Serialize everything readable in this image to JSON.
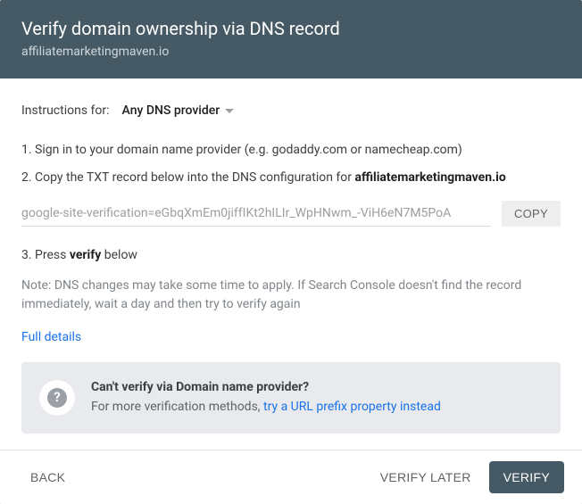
{
  "header": {
    "title": "Verify domain ownership via DNS record",
    "subtitle": "affiliatemarketingmaven.io"
  },
  "instructions": {
    "label": "Instructions for:",
    "provider": "Any DNS provider"
  },
  "steps": {
    "step1": "1. Sign in to your domain name provider (e.g. godaddy.com or namecheap.com)",
    "step2_prefix": "2. Copy the TXT record below into the DNS configuration for ",
    "step2_domain": "affiliatemarketingmaven.io",
    "step3_prefix": "3. Press ",
    "step3_bold": "verify",
    "step3_suffix": " below"
  },
  "txt": {
    "value": "google-site-verification=eGbqXmEm0jiffIKt2hILIr_WpHNwm_-ViH6eN7M5PoA",
    "copy_label": "COPY"
  },
  "note": "Note: DNS changes may take some time to apply. If Search Console doesn't find the record immediately, wait a day and then try to verify again",
  "full_details": "Full details",
  "info": {
    "heading": "Can't verify via Domain name provider?",
    "body_prefix": "For more verification methods, ",
    "body_link": "try a URL prefix property instead"
  },
  "footer": {
    "back": "BACK",
    "verify_later": "VERIFY LATER",
    "verify": "VERIFY"
  }
}
